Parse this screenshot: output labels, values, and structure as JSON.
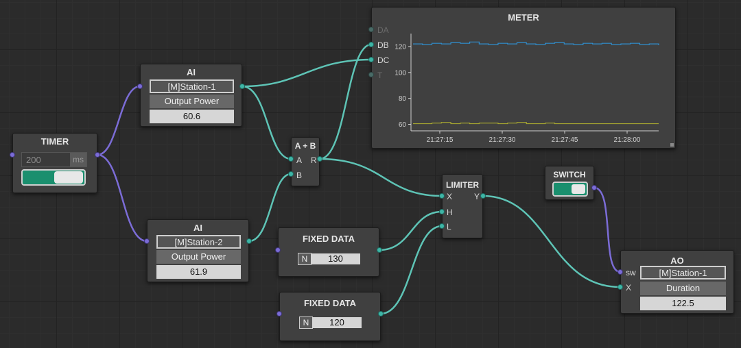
{
  "colors": {
    "wire_data": "#5ec4b6",
    "wire_signal": "#7b6cd6",
    "toggle_on": "#1a8f6e",
    "series_db": "#2f8fd0",
    "series_dc": "#a8a830"
  },
  "timer": {
    "title": "TIMER",
    "value": "200",
    "unit": "ms",
    "enabled": true
  },
  "ai1": {
    "title": "AI",
    "station": "[M]Station-1",
    "param": "Output Power",
    "value": "60.6"
  },
  "ai2": {
    "title": "AI",
    "station": "[M]Station-2",
    "param": "Output Power",
    "value": "61.9"
  },
  "add": {
    "title": "A + B",
    "ports": {
      "a": "A",
      "b": "B",
      "r": "R"
    }
  },
  "fixed1": {
    "title": "FIXED DATA",
    "type": "N",
    "value": "130"
  },
  "fixed2": {
    "title": "FIXED DATA",
    "type": "N",
    "value": "120"
  },
  "limiter": {
    "title": "LIMITER",
    "ports": {
      "x": "X",
      "h": "H",
      "l": "L",
      "y": "Y"
    }
  },
  "switch": {
    "title": "SWITCH",
    "enabled": true
  },
  "ao": {
    "title": "AO",
    "station": "[M]Station-1",
    "param": "Duration",
    "value": "122.5",
    "ports": {
      "sw": "sw",
      "x": "X"
    }
  },
  "meter": {
    "title": "METER",
    "ports": [
      "DA",
      "DB",
      "DC",
      "T"
    ],
    "chart_data": {
      "type": "line",
      "x_ticks": [
        "21:27:15",
        "21:27:30",
        "21:27:45",
        "21:28:00"
      ],
      "y_ticks": [
        60,
        80,
        100,
        120
      ],
      "ylim": [
        55,
        130
      ],
      "series": [
        {
          "name": "DB",
          "values": [
            122,
            121.5,
            122.5,
            122,
            123,
            122.5,
            123.5,
            122,
            121.5,
            122.5,
            122,
            123,
            122,
            121.5,
            122.5,
            123,
            122,
            121.5,
            122.5,
            122,
            122.5,
            121.5,
            122,
            122.5,
            121.5,
            122,
            121
          ]
        },
        {
          "name": "DC",
          "values": [
            60.5,
            60.5,
            61,
            61.5,
            60.5,
            61,
            60.5,
            61,
            61,
            60.5,
            61,
            61.5,
            60.5,
            60.5,
            61,
            60.5,
            60.5,
            60.5,
            60.5,
            60.5,
            60.5,
            60.5,
            60.5,
            60.5,
            60.5,
            60.5,
            60.5
          ]
        }
      ]
    }
  }
}
